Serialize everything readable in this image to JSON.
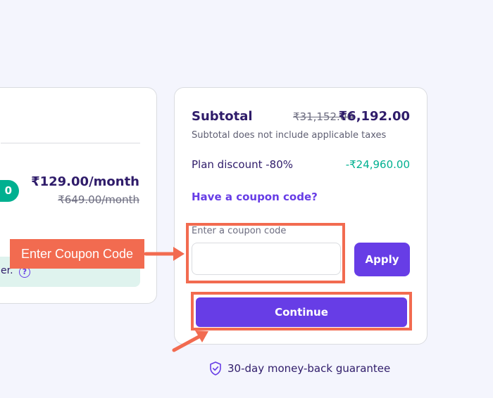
{
  "left_card": {
    "badge_fragment": "0",
    "price": "₹129.00/month",
    "old_price": "₹649.00/month",
    "info_text_fragment": "er.",
    "help_icon": "question-circle-icon"
  },
  "summary": {
    "subtotal_label": "Subtotal",
    "subtotal_old": "₹31,152.00",
    "subtotal_new": "₹6,192.00",
    "subtotal_note": "Subtotal does not include applicable taxes",
    "discount_label": "Plan discount -80%",
    "discount_value": "-₹24,960.00",
    "coupon_link": "Have a coupon code?",
    "coupon_field_label": "Enter a coupon code",
    "coupon_value": "",
    "apply_label": "Apply",
    "continue_label": "Continue"
  },
  "guarantee": {
    "icon": "shield-check-icon",
    "text": "30-day money-back guarantee"
  },
  "annotation": {
    "label": "Enter Coupon Code",
    "color": "#f26b50"
  },
  "colors": {
    "accent": "#673de6",
    "success": "#00b090",
    "text": "#2f1c6a"
  }
}
